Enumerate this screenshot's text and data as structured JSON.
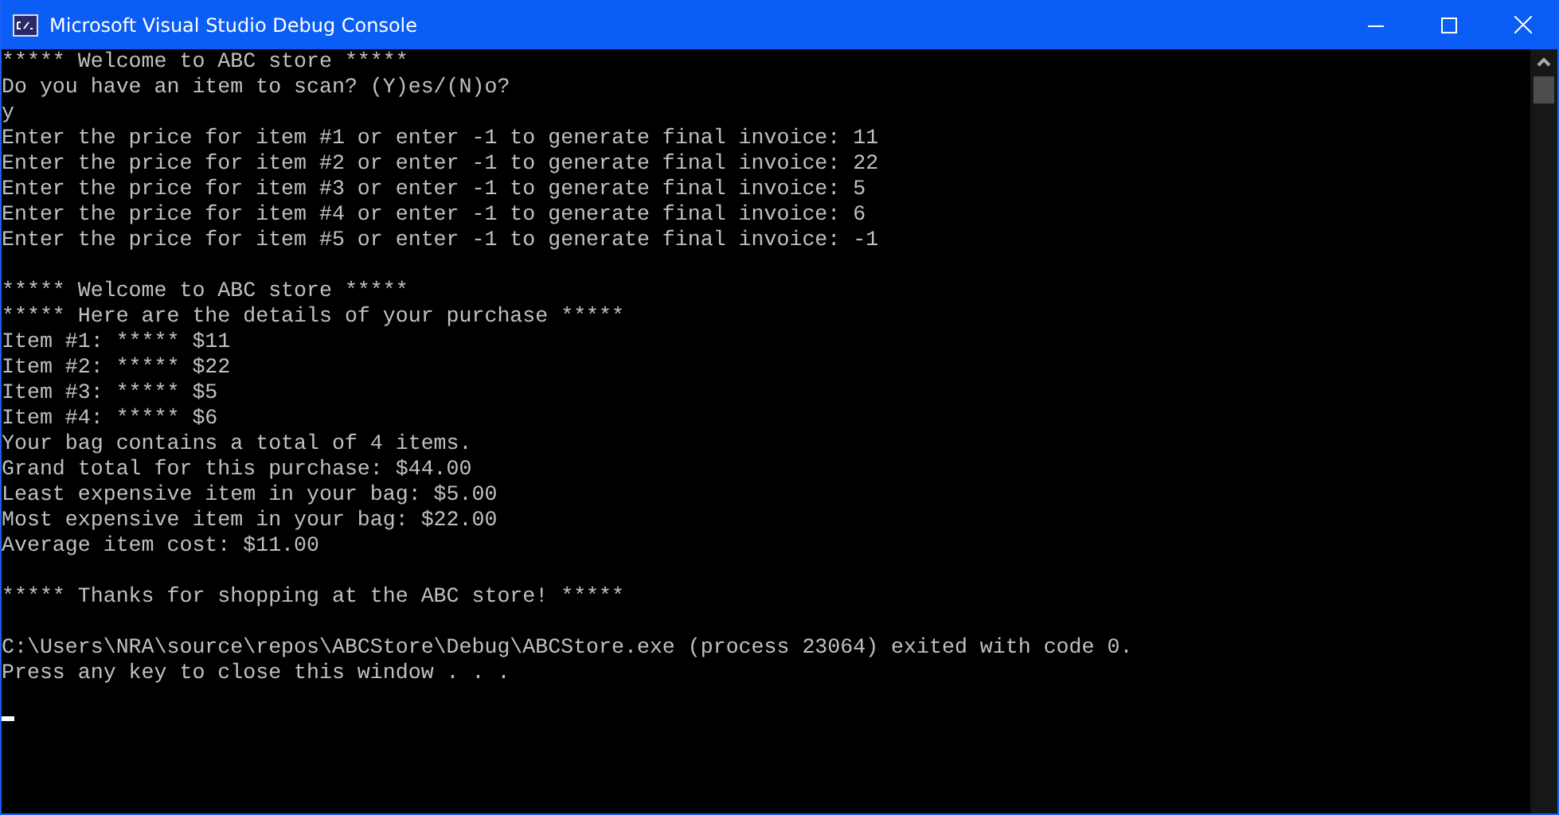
{
  "window": {
    "title": "Microsoft Visual Studio Debug Console"
  },
  "console": {
    "blocks": [
      [
        "***** Welcome to ABC store *****",
        "Do you have an item to scan? (Y)es/(N)o?",
        "y",
        "Enter the price for item #1 or enter -1 to generate final invoice: 11",
        "Enter the price for item #2 or enter -1 to generate final invoice: 22",
        "Enter the price for item #3 or enter -1 to generate final invoice: 5",
        "Enter the price for item #4 or enter -1 to generate final invoice: 6",
        "Enter the price for item #5 or enter -1 to generate final invoice: -1"
      ],
      [
        "***** Welcome to ABC store *****",
        "***** Here are the details of your purchase *****",
        "Item #1: ***** $11",
        "Item #2: ***** $22",
        "Item #3: ***** $5",
        "Item #4: ***** $6",
        "Your bag contains a total of 4 items.",
        "Grand total for this purchase: $44.00",
        "Least expensive item in your bag: $5.00",
        "Most expensive item in your bag: $22.00",
        "Average item cost: $11.00"
      ],
      [
        "***** Thanks for shopping at the ABC store! *****"
      ],
      [
        "C:\\Users\\NRA\\source\\repos\\ABCStore\\Debug\\ABCStore.exe (process 23064) exited with code 0.",
        "Press any key to close this window . . ."
      ]
    ]
  }
}
